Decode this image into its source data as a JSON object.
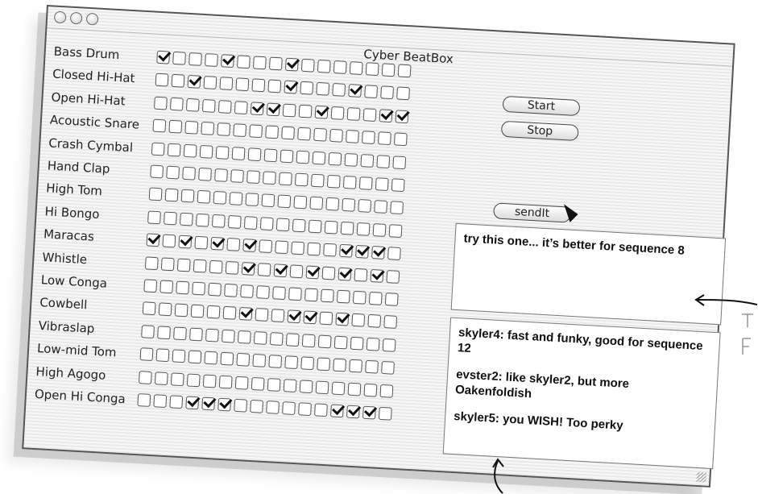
{
  "window": {
    "title": "Cyber BeatBox"
  },
  "instruments": [
    {
      "label": "Bass Drum",
      "beats": [
        1,
        0,
        0,
        0,
        1,
        0,
        0,
        0,
        1,
        0,
        0,
        0,
        0,
        0,
        0,
        0
      ]
    },
    {
      "label": "Closed Hi-Hat",
      "beats": [
        0,
        0,
        1,
        0,
        0,
        0,
        0,
        0,
        1,
        0,
        0,
        0,
        1,
        0,
        0,
        0
      ]
    },
    {
      "label": "Open Hi-Hat",
      "beats": [
        0,
        0,
        0,
        0,
        0,
        0,
        1,
        1,
        0,
        0,
        1,
        0,
        0,
        0,
        1,
        1
      ]
    },
    {
      "label": "Acoustic Snare",
      "beats": [
        0,
        0,
        0,
        0,
        0,
        0,
        0,
        0,
        0,
        0,
        0,
        0,
        0,
        0,
        0,
        0
      ]
    },
    {
      "label": "Crash Cymbal",
      "beats": [
        0,
        0,
        0,
        0,
        0,
        0,
        0,
        0,
        0,
        0,
        0,
        0,
        0,
        0,
        0,
        0
      ]
    },
    {
      "label": "Hand Clap",
      "beats": [
        0,
        0,
        0,
        0,
        0,
        0,
        0,
        0,
        0,
        0,
        0,
        0,
        0,
        0,
        0,
        0
      ]
    },
    {
      "label": "High Tom",
      "beats": [
        0,
        0,
        0,
        0,
        0,
        0,
        0,
        0,
        0,
        0,
        0,
        0,
        0,
        0,
        0,
        0
      ]
    },
    {
      "label": "Hi Bongo",
      "beats": [
        0,
        0,
        0,
        0,
        0,
        0,
        0,
        0,
        0,
        0,
        0,
        0,
        0,
        0,
        0,
        0
      ]
    },
    {
      "label": "Maracas",
      "beats": [
        1,
        0,
        1,
        0,
        1,
        0,
        1,
        0,
        0,
        0,
        0,
        0,
        1,
        1,
        1,
        0
      ]
    },
    {
      "label": "Whistle",
      "beats": [
        0,
        0,
        0,
        0,
        0,
        0,
        1,
        0,
        1,
        0,
        1,
        0,
        1,
        0,
        1,
        0
      ]
    },
    {
      "label": "Low Conga",
      "beats": [
        0,
        0,
        0,
        0,
        0,
        0,
        0,
        0,
        0,
        0,
        0,
        0,
        0,
        0,
        0,
        0
      ]
    },
    {
      "label": "Cowbell",
      "beats": [
        0,
        0,
        0,
        0,
        0,
        0,
        1,
        0,
        0,
        1,
        1,
        0,
        1,
        0,
        0,
        0
      ]
    },
    {
      "label": "Vibraslap",
      "beats": [
        0,
        0,
        0,
        0,
        0,
        0,
        0,
        0,
        0,
        0,
        0,
        0,
        0,
        0,
        0,
        0
      ]
    },
    {
      "label": "Low-mid Tom",
      "beats": [
        0,
        0,
        0,
        0,
        0,
        0,
        0,
        0,
        0,
        0,
        0,
        0,
        0,
        0,
        0,
        0
      ]
    },
    {
      "label": "High Agogo",
      "beats": [
        0,
        0,
        0,
        0,
        0,
        0,
        0,
        0,
        0,
        0,
        0,
        0,
        0,
        0,
        0,
        0
      ]
    },
    {
      "label": "Open Hi Conga",
      "beats": [
        0,
        0,
        0,
        1,
        1,
        1,
        0,
        0,
        0,
        0,
        0,
        0,
        1,
        1,
        1,
        0
      ]
    }
  ],
  "buttons": {
    "start": "Start",
    "stop": "Stop",
    "send": "sendIt"
  },
  "outgoing_message": "try this one... it’s better for sequence 8",
  "incoming_messages": [
    "skyler4: fast and funky, good for sequence 12",
    "evster2: like skyler2, but more Oakenfoldish",
    "skyler5: you WISH! Too perky"
  ]
}
